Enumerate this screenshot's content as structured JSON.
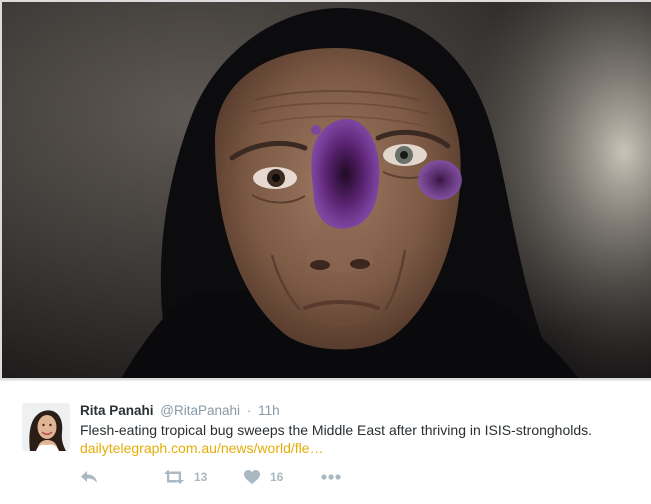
{
  "photo": {
    "description_icon": "photo-image"
  },
  "tweet": {
    "author_name": "Rita Panahi",
    "author_handle": "@RitaPanahi",
    "separator": "·",
    "time": "11h",
    "text": "Flesh-eating tropical bug sweeps the Middle East after thriving in ISIS-strongholds.",
    "link": "dailytelegraph.com.au/news/world/fle…",
    "link_color": "#e5ad08"
  },
  "actions": {
    "reply_icon": "reply-icon",
    "retweet_icon": "retweet-icon",
    "retweet_count": "13",
    "like_icon": "heart-icon",
    "like_count": "16",
    "more_icon": "more-icon"
  }
}
